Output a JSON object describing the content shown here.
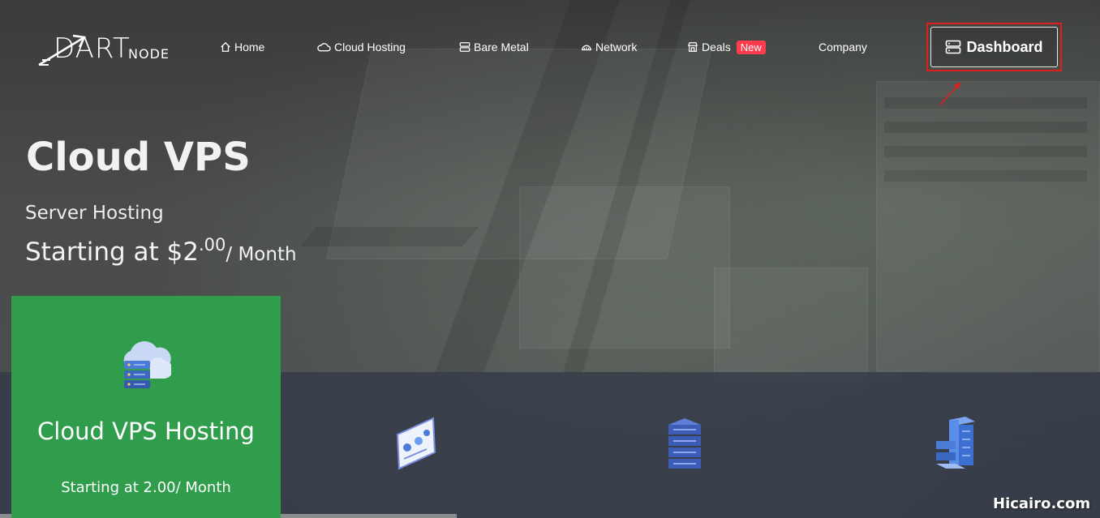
{
  "header": {
    "logo_main": "DART",
    "logo_sub": "NODE",
    "nav": [
      {
        "label": "Home",
        "icon": "home-icon"
      },
      {
        "label": "Cloud Hosting",
        "icon": "cloud-icon"
      },
      {
        "label": "Bare Metal",
        "icon": "server-icon"
      },
      {
        "label": "Network",
        "icon": "network-icon"
      },
      {
        "label": "Deals",
        "icon": "store-icon",
        "badge": "New"
      },
      {
        "label": "Company"
      }
    ],
    "dashboard_label": "Dashboard"
  },
  "hero": {
    "title": "Cloud VPS",
    "subtitle": "Server Hosting",
    "price_prefix": "Starting at $2",
    "price_cents": ".00",
    "price_suffix": "/ Month"
  },
  "card": {
    "title": "Cloud VPS Hosting",
    "subtitle": "Starting at 2.00/ Month",
    "icon": "cloud-server-icon"
  },
  "features": [
    {
      "icon": "dashboard-chart-icon"
    },
    {
      "icon": "server-stack-icon"
    },
    {
      "icon": "server-rack-icon"
    }
  ],
  "watermark": "Hicairo.com",
  "colors": {
    "card_green": "#2f9d4b",
    "badge_red": "#ff3b4e",
    "highlight_red": "#e01e1e",
    "icon_blue": "#4a7bd6"
  }
}
